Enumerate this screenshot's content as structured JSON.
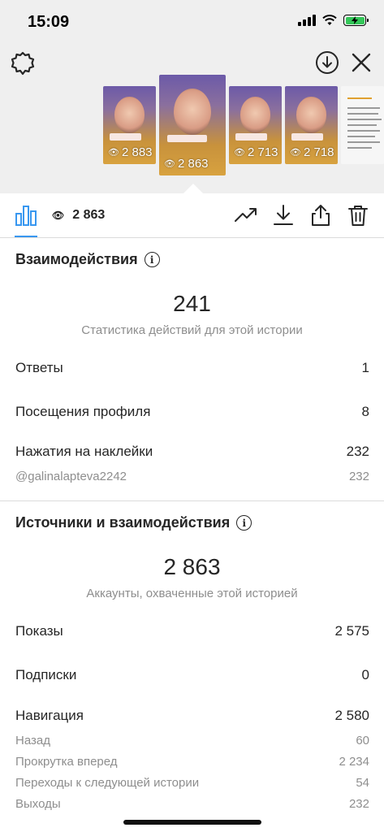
{
  "status_bar": {
    "time": "15:09"
  },
  "thumbnails": [
    {
      "views": "2 883"
    },
    {
      "views": "2 863",
      "selected": true
    },
    {
      "views": "2 713"
    },
    {
      "views": "2 718"
    },
    {
      "views": ""
    }
  ],
  "toolbar": {
    "views": "2 863"
  },
  "interactions": {
    "title": "Взаимодействия",
    "total": "241",
    "caption": "Статистика действий для этой истории",
    "rows": [
      {
        "label": "Ответы",
        "value": "1"
      },
      {
        "label": "Посещения профиля",
        "value": "8"
      },
      {
        "label": "Нажатия на наклейки",
        "value": "232"
      }
    ],
    "sub_rows": [
      {
        "label": "@galinalapteva2242",
        "value": "232"
      }
    ]
  },
  "discovery": {
    "title": "Источники и взаимодействия",
    "total": "2 863",
    "caption": "Аккаунты, охваченные этой историей",
    "rows": [
      {
        "label": "Показы",
        "value": "2 575"
      },
      {
        "label": "Подписки",
        "value": "0"
      },
      {
        "label": "Навигация",
        "value": "2 580"
      }
    ],
    "sub_rows": [
      {
        "label": "Назад",
        "value": "60"
      },
      {
        "label": "Прокрутка вперед",
        "value": "2 234"
      },
      {
        "label": "Переходы к следующей истории",
        "value": "54"
      },
      {
        "label": "Выходы",
        "value": "232"
      }
    ]
  }
}
